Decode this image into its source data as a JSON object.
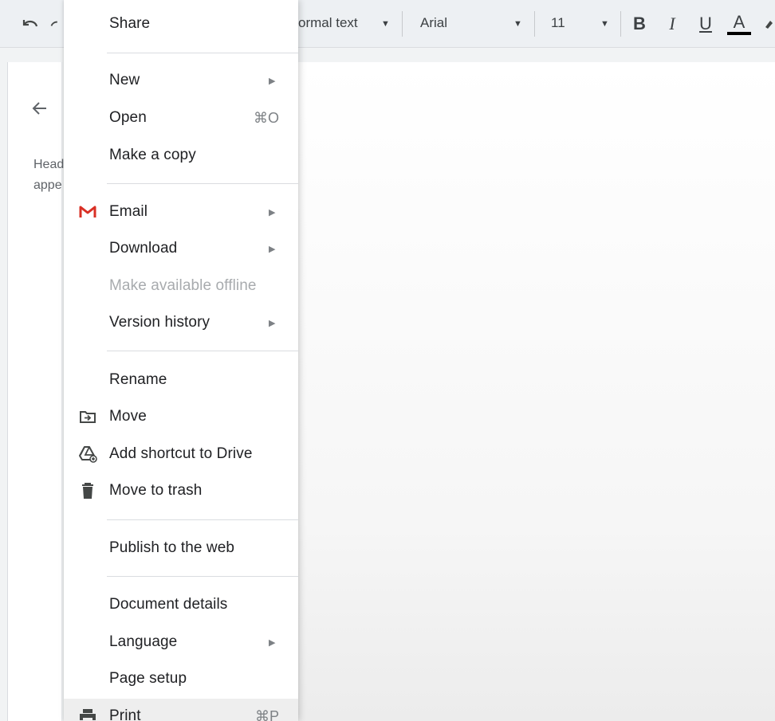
{
  "toolbar": {
    "style_value": "ormal text",
    "font_value": "Arial",
    "size_value": "11",
    "bold_label": "B",
    "italic_label": "I",
    "underline_label": "U",
    "text_color_label": "A",
    "icons": {
      "undo": "undo-icon",
      "redo": "redo-icon",
      "highlight": "highlight-pen-icon"
    }
  },
  "outline": {
    "back_icon": "arrow-left-icon",
    "text_line1": "Head",
    "text_line2": "appe"
  },
  "file_menu": {
    "items": [
      {
        "label": "Share"
      },
      {
        "label": "New",
        "submenu": true
      },
      {
        "label": "Open",
        "shortcut": "⌘O"
      },
      {
        "label": "Make a copy"
      },
      {
        "label": "Email",
        "submenu": true,
        "icon": "gmail-icon"
      },
      {
        "label": "Download",
        "submenu": true
      },
      {
        "label": "Make available offline",
        "disabled": true
      },
      {
        "label": "Version history",
        "submenu": true
      },
      {
        "label": "Rename"
      },
      {
        "label": "Move",
        "icon": "folder-move-icon"
      },
      {
        "label": "Add shortcut to Drive",
        "icon": "drive-add-icon"
      },
      {
        "label": "Move to trash",
        "icon": "trash-icon"
      },
      {
        "label": "Publish to the web"
      },
      {
        "label": "Document details"
      },
      {
        "label": "Language",
        "submenu": true
      },
      {
        "label": "Page setup"
      },
      {
        "label": "Print",
        "shortcut": "⌘P",
        "icon": "printer-icon"
      }
    ]
  },
  "colors": {
    "gmail_red": "#d93025",
    "toolbar_bg": "#edf0f3",
    "menu_bg": "#ffffff",
    "disabled_text": "#a8abae"
  }
}
